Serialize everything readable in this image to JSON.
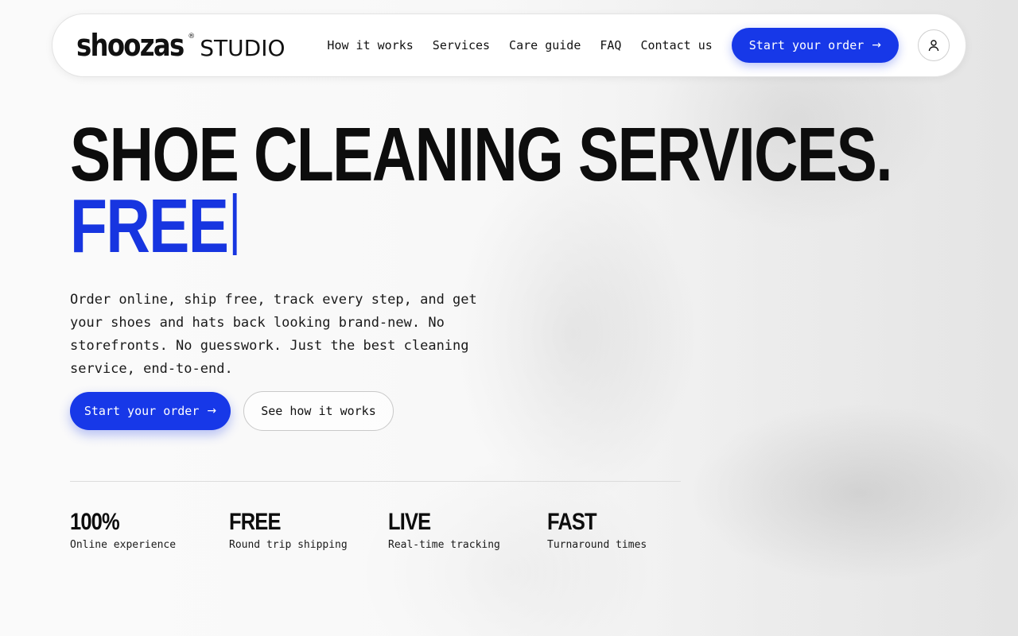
{
  "brand": {
    "name": "shoozas",
    "registered": "®",
    "sub": "STUDIO"
  },
  "nav": {
    "links": [
      "How it works",
      "Services",
      "Care guide",
      "FAQ",
      "Contact us"
    ],
    "cta_label": "Start your order",
    "user_icon": "user-icon"
  },
  "hero": {
    "title_line1": "SHOE CLEANING SERVICES.",
    "title_line2": "FREE",
    "description": "Order online, ship free, track every step, and get your shoes and hats back looking brand-new. No storefronts. No guesswork. Just the best cleaning service, end-to-end.",
    "primary_label": "Start your order",
    "secondary_label": "See how it works"
  },
  "stats": [
    {
      "value": "100%",
      "label": "Online experience"
    },
    {
      "value": "FREE",
      "label": "Round trip shipping"
    },
    {
      "value": "LIVE",
      "label": "Real-time tracking"
    },
    {
      "value": "FAST",
      "label": "Turnaround times"
    }
  ],
  "colors": {
    "accent": "#1738e8",
    "text": "#111111",
    "background": "#f3f3f3"
  }
}
